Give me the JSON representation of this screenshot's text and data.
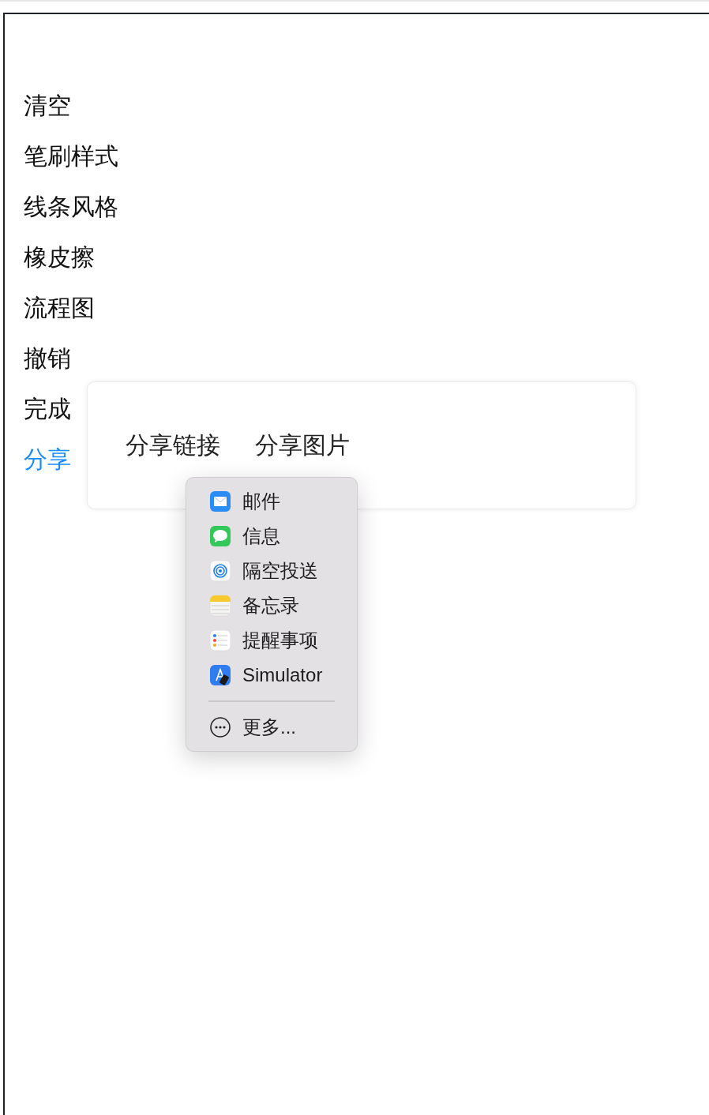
{
  "toolbar": {
    "items": [
      {
        "label": "清空",
        "selected": false
      },
      {
        "label": "笔刷样式",
        "selected": false
      },
      {
        "label": "线条风格",
        "selected": false
      },
      {
        "label": "橡皮擦",
        "selected": false
      },
      {
        "label": "流程图",
        "selected": false
      },
      {
        "label": "撤销",
        "selected": false
      },
      {
        "label": "完成",
        "selected": false
      },
      {
        "label": "分享",
        "selected": true
      }
    ]
  },
  "share_card": {
    "options": [
      "分享链接",
      "分享图片"
    ]
  },
  "share_menu": {
    "items": [
      {
        "kind": "mail",
        "label": "邮件"
      },
      {
        "kind": "messages",
        "label": "信息"
      },
      {
        "kind": "airdrop",
        "label": "隔空投送"
      },
      {
        "kind": "notes",
        "label": "备忘录"
      },
      {
        "kind": "reminders",
        "label": "提醒事项"
      },
      {
        "kind": "simulator",
        "label": "Simulator"
      },
      {
        "kind": "more",
        "label": "更多..."
      }
    ]
  }
}
